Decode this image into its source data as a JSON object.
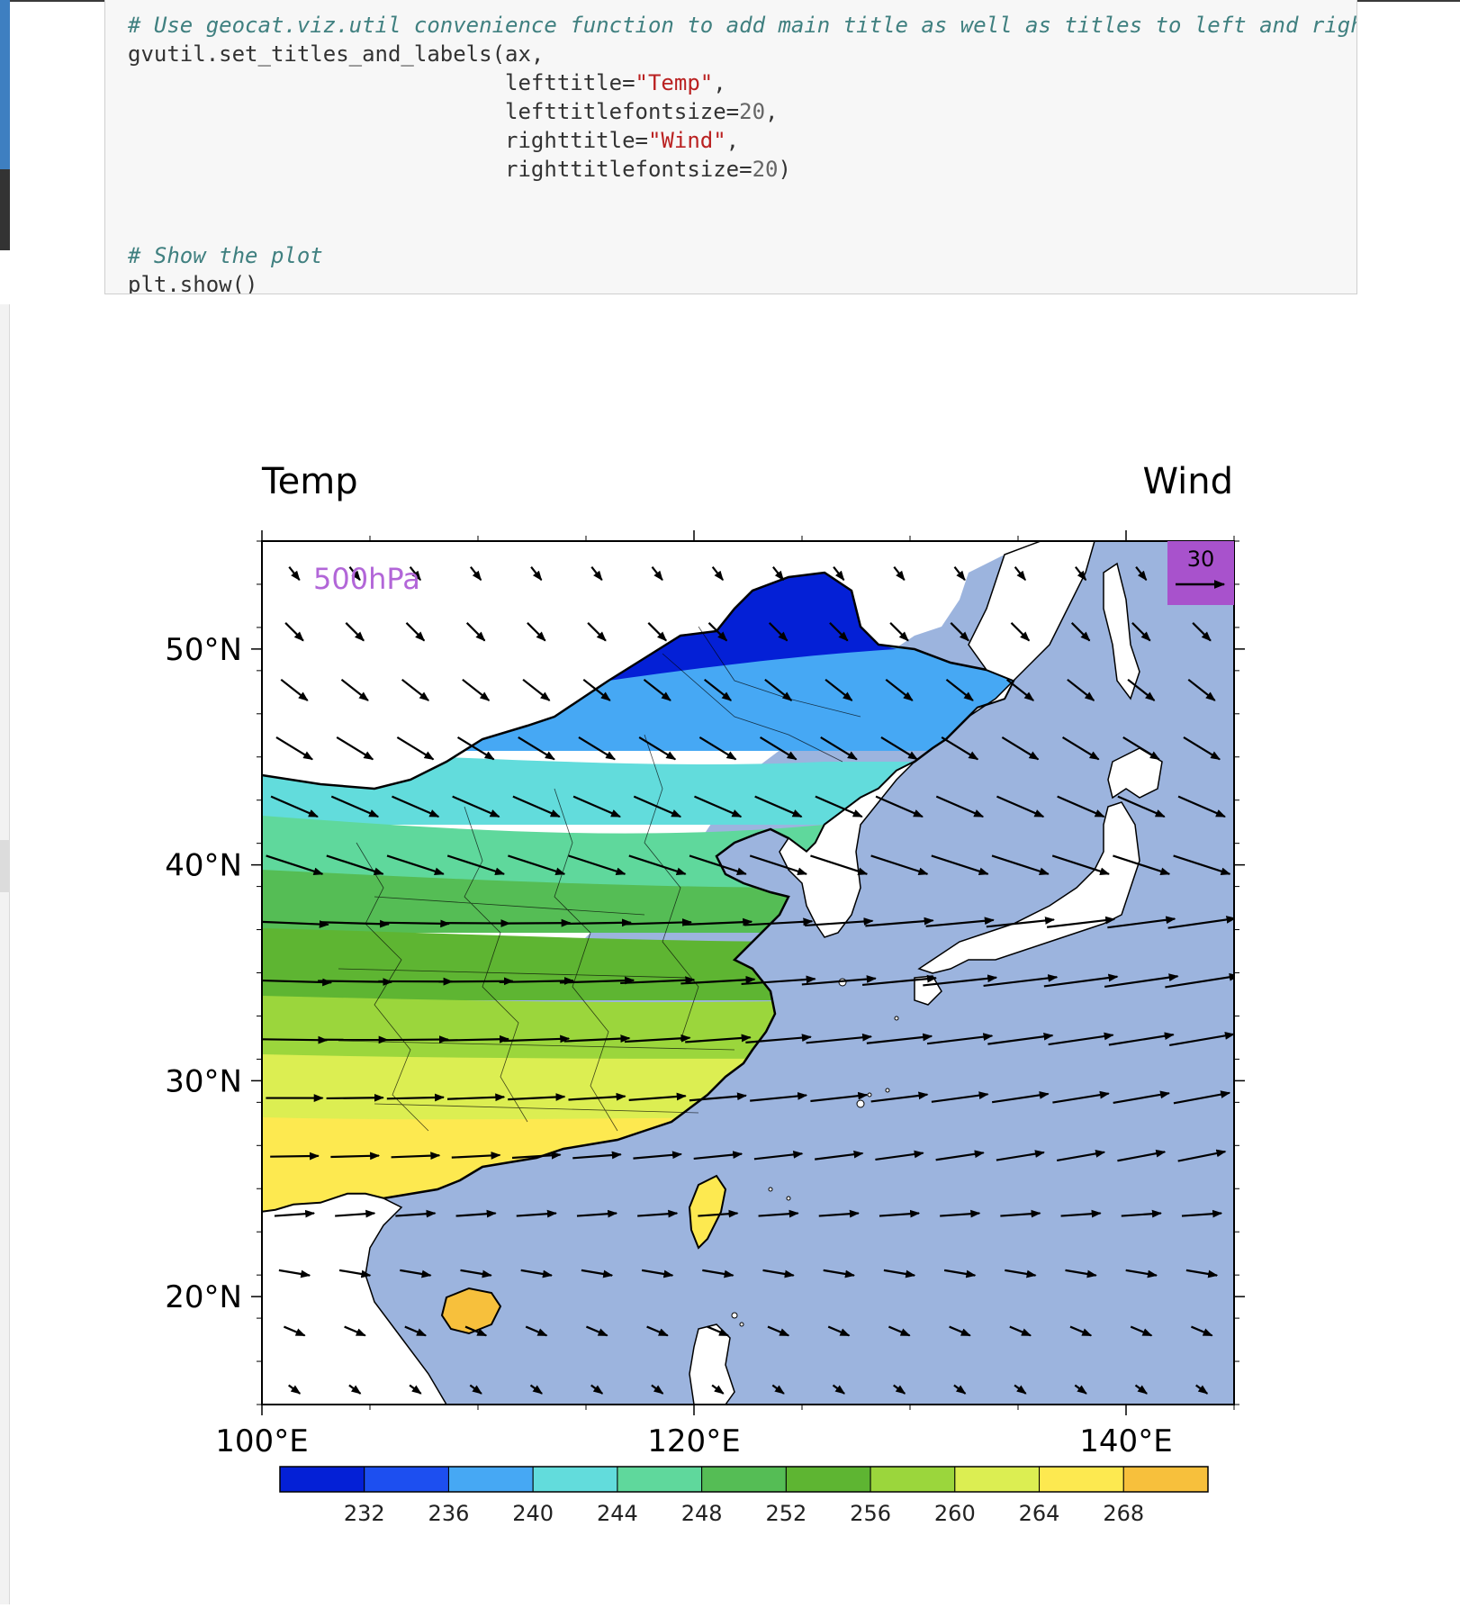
{
  "code": {
    "lines": [
      {
        "parts": [
          {
            "t": "# Use geocat.viz.util convenience function to add main title as well as titles to left and righ",
            "c": "comment"
          }
        ]
      },
      {
        "parts": [
          {
            "t": "gvutil.set_titles_and_labels(ax,",
            "c": "plain"
          }
        ]
      },
      {
        "parts": [
          {
            "t": "                             lefttitle=",
            "c": "plain"
          },
          {
            "t": "\"Temp\"",
            "c": "str"
          },
          {
            "t": ",",
            "c": "plain"
          }
        ]
      },
      {
        "parts": [
          {
            "t": "                             lefttitlefontsize=",
            "c": "plain"
          },
          {
            "t": "20",
            "c": "num"
          },
          {
            "t": ",",
            "c": "plain"
          }
        ]
      },
      {
        "parts": [
          {
            "t": "                             righttitle=",
            "c": "plain"
          },
          {
            "t": "\"Wind\"",
            "c": "str"
          },
          {
            "t": ",",
            "c": "plain"
          }
        ]
      },
      {
        "parts": [
          {
            "t": "                             righttitlefontsize=",
            "c": "plain"
          },
          {
            "t": "20",
            "c": "num"
          },
          {
            "t": ")",
            "c": "plain"
          }
        ]
      },
      {
        "parts": [
          {
            "t": "",
            "c": "plain"
          }
        ]
      },
      {
        "parts": [
          {
            "t": "",
            "c": "plain"
          }
        ]
      },
      {
        "parts": [
          {
            "t": "# Show the plot",
            "c": "comment"
          }
        ]
      },
      {
        "parts": [
          {
            "t": "plt.show()",
            "c": "plain"
          }
        ]
      }
    ]
  },
  "plot": {
    "left_title": "Temp",
    "right_title": "Wind",
    "level_label": "500hPa",
    "reference_vector_label": "30",
    "x_tick_labels": [
      "100°E",
      "120°E",
      "140°E"
    ],
    "y_tick_labels": [
      "50°N",
      "40°N",
      "30°N",
      "20°N"
    ],
    "colorbar_labels": [
      "232",
      "236",
      "240",
      "244",
      "248",
      "252",
      "256",
      "260",
      "264",
      "268"
    ],
    "colors": {
      "ocean": "#9cb4de",
      "level_label": "#b266d8",
      "ref_box": "#a852cc",
      "colorbar": [
        "#0420d6",
        "#1d4ff0",
        "#46a8f4",
        "#62dcdc",
        "#5fd89c",
        "#55bd55",
        "#5eb532",
        "#9bd63c",
        "#dcee52",
        "#fde950",
        "#f7c03c"
      ]
    }
  },
  "chart_data": {
    "type": "heatmap",
    "title": "",
    "left_title": "Temp",
    "right_title": "Wind",
    "annotation": "500hPa",
    "xlabel": "",
    "ylabel": "",
    "xlim": [
      100,
      145
    ],
    "ylim": [
      15,
      55
    ],
    "x_ticks": [
      100,
      120,
      140
    ],
    "y_ticks": [
      20,
      30,
      40,
      50
    ],
    "colorbar_levels": [
      228,
      232,
      236,
      240,
      244,
      248,
      252,
      256,
      260,
      264,
      268,
      272
    ],
    "colorbar_tick_values": [
      232,
      236,
      240,
      244,
      248,
      252,
      256,
      260,
      264,
      268
    ],
    "temperature_bands_over_land": [
      {
        "lat_range": [
          48.5,
          54
        ],
        "temp_range": [
          228,
          232
        ]
      },
      {
        "lat_range": [
          45,
          48.5
        ],
        "temp_range": [
          232,
          236
        ]
      },
      {
        "lat_range": [
          42,
          45
        ],
        "temp_range": [
          236,
          240
        ]
      },
      {
        "lat_range": [
          38,
          42
        ],
        "temp_range": [
          240,
          244
        ]
      },
      {
        "lat_range": [
          35,
          38
        ],
        "temp_range": [
          244,
          248
        ]
      },
      {
        "lat_range": [
          32,
          35
        ],
        "temp_range": [
          248,
          252
        ]
      },
      {
        "lat_range": [
          28.5,
          32
        ],
        "temp_range": [
          252,
          256
        ]
      },
      {
        "lat_range": [
          25,
          28.5
        ],
        "temp_range": [
          256,
          260
        ]
      },
      {
        "lat_range": [
          22,
          25
        ],
        "temp_range": [
          260,
          264
        ]
      },
      {
        "lat_range": [
          18,
          22
        ],
        "temp_range": [
          264,
          268
        ]
      }
    ],
    "wind_reference_vector": 30
  }
}
